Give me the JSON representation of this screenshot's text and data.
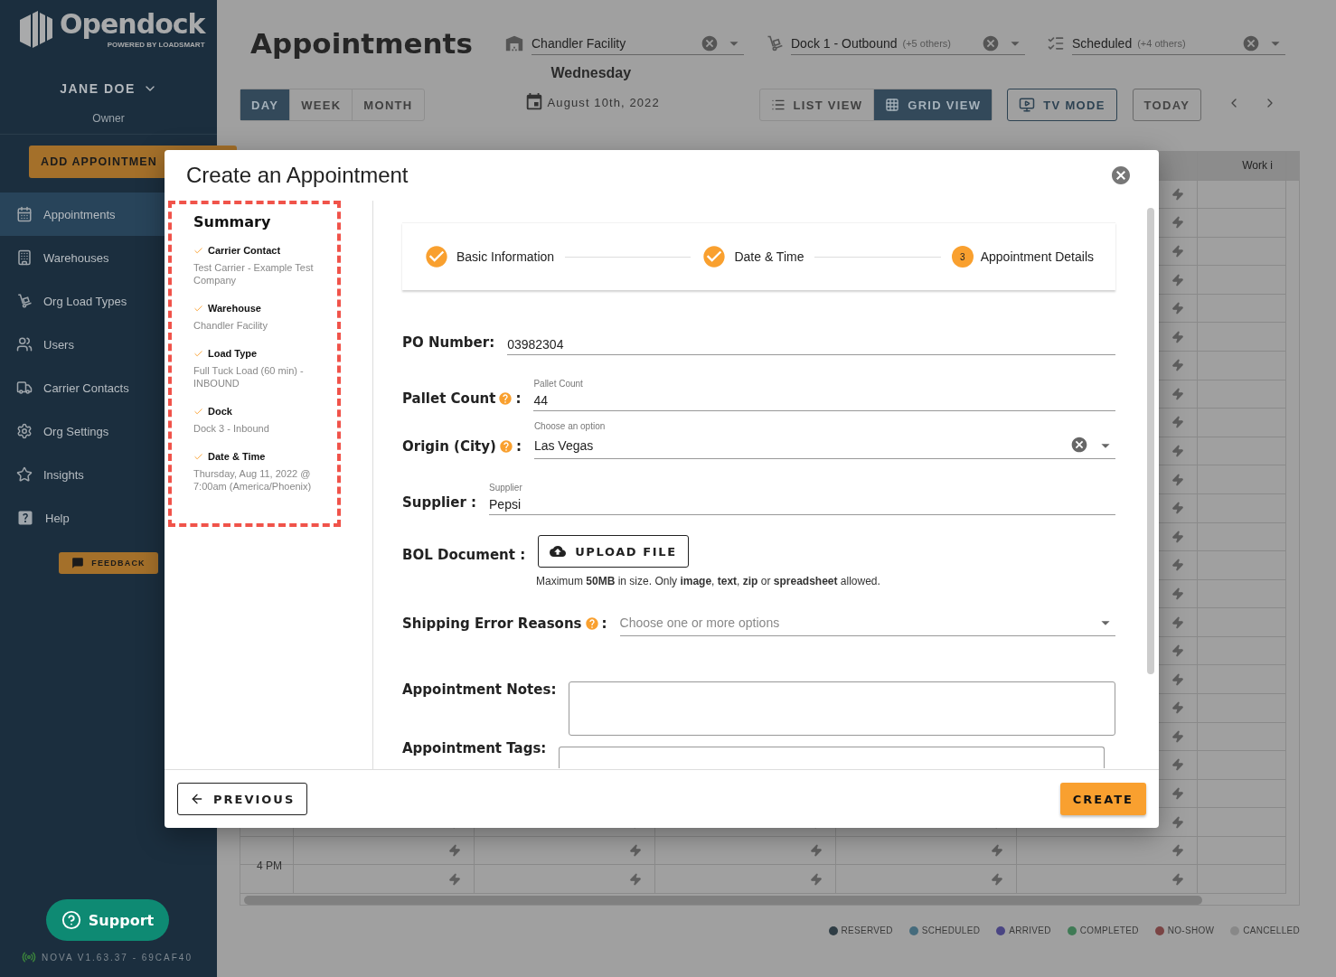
{
  "sidebar": {
    "logo": {
      "name": "Opendock",
      "tagline": "POWERED BY LOADSMART"
    },
    "user": {
      "name": "JANE DOE",
      "role": "Owner"
    },
    "add_button": "ADD APPOINTMEN",
    "items": [
      {
        "label": "Appointments",
        "selected": true
      },
      {
        "label": "Warehouses",
        "selected": false
      },
      {
        "label": "Org Load Types",
        "selected": false
      },
      {
        "label": "Users",
        "selected": false
      },
      {
        "label": "Carrier Contacts",
        "selected": false
      },
      {
        "label": "Org Settings",
        "selected": false
      },
      {
        "label": "Insights",
        "selected": false
      },
      {
        "label": "Help",
        "selected": false
      }
    ],
    "feedback": "FEEDBACK",
    "support": "Support",
    "version": "NOVA V1.63.37 - 69CAF40"
  },
  "header": {
    "title": "Appointments",
    "filters": [
      {
        "value": "Chandler Facility"
      },
      {
        "value": "Dock 1 - Outbound",
        "others": "(+5 others)"
      },
      {
        "value": "Scheduled",
        "others": "(+4 others)"
      }
    ],
    "weekday": "Wednesday",
    "date": "August 10th, 2022",
    "range_tabs": [
      {
        "label": "DAY",
        "selected": true
      },
      {
        "label": "WEEK",
        "selected": false
      },
      {
        "label": "MONTH",
        "selected": false
      }
    ],
    "view_tabs": [
      {
        "label": "LIST VIEW",
        "selected": false
      },
      {
        "label": "GRID VIEW",
        "selected": true
      }
    ],
    "tv_mode": "TV MODE",
    "today": "TODAY"
  },
  "calendar": {
    "column_7": "Work i",
    "time_label": "4 PM"
  },
  "legend": [
    {
      "label": "RESERVED",
      "color": "#2f3d45"
    },
    {
      "label": "SCHEDULED",
      "color": "#456b7c"
    },
    {
      "label": "ARRIVED",
      "color": "#4a4583"
    },
    {
      "label": "COMPLETED",
      "color": "#3f7a55"
    },
    {
      "label": "NO-SHOW",
      "color": "#7a4444"
    },
    {
      "label": "CANCELLED",
      "color": "#888888"
    }
  ],
  "dialog": {
    "title": "Create an Appointment",
    "summary": {
      "title": "Summary",
      "items": [
        {
          "label": "Carrier Contact",
          "value": "Test Carrier - Example Test Company",
          "checked": true
        },
        {
          "label": "Warehouse",
          "value": "Chandler Facility",
          "checked": true
        },
        {
          "label": "Load Type",
          "value": "Full Tuck Load (60 min) - INBOUND",
          "checked": true
        },
        {
          "label": "Dock",
          "value": "Dock 3 - Inbound",
          "checked": true
        },
        {
          "label": "Date & Time",
          "value": "Thursday, Aug 11, 2022 @ 7:00am (America/Phoenix)",
          "checked": true
        }
      ]
    },
    "steps": [
      {
        "label": "Basic Information",
        "complete": true
      },
      {
        "label": "Date & Time",
        "complete": true
      },
      {
        "label": "Appointment Details",
        "number": "3",
        "complete": false
      }
    ],
    "fields": [
      {
        "kind": "text",
        "label": "PO Number:",
        "value": "03982304"
      },
      {
        "kind": "text",
        "label": "Pallet Count",
        "help": true,
        "colon": ":",
        "floating_label": "Pallet Count",
        "value": "44"
      },
      {
        "kind": "select",
        "label": "Origin (City)",
        "help": true,
        "colon": ":",
        "floating_label": "Choose an option",
        "value": "Las Vegas"
      },
      {
        "kind": "text",
        "label": "Supplier :",
        "floating_label": "Supplier",
        "value": "Pepsi"
      },
      {
        "kind": "upload",
        "label": "BOL Document :",
        "button": "UPLOAD FILE",
        "hint": "Maximum **50MB** in size. Only **image**, **text**, **zip** or **spreadsheet** allowed."
      },
      {
        "kind": "multiselect",
        "label": "Shipping Error Reasons",
        "help": true,
        "colon": ":",
        "placeholder": "Choose one or more options"
      },
      {
        "kind": "textarea",
        "label": "Appointment Notes:"
      },
      {
        "kind": "tags",
        "label": "Appointment Tags:"
      }
    ],
    "previous": "PREVIOUS",
    "create": "CREATE"
  }
}
